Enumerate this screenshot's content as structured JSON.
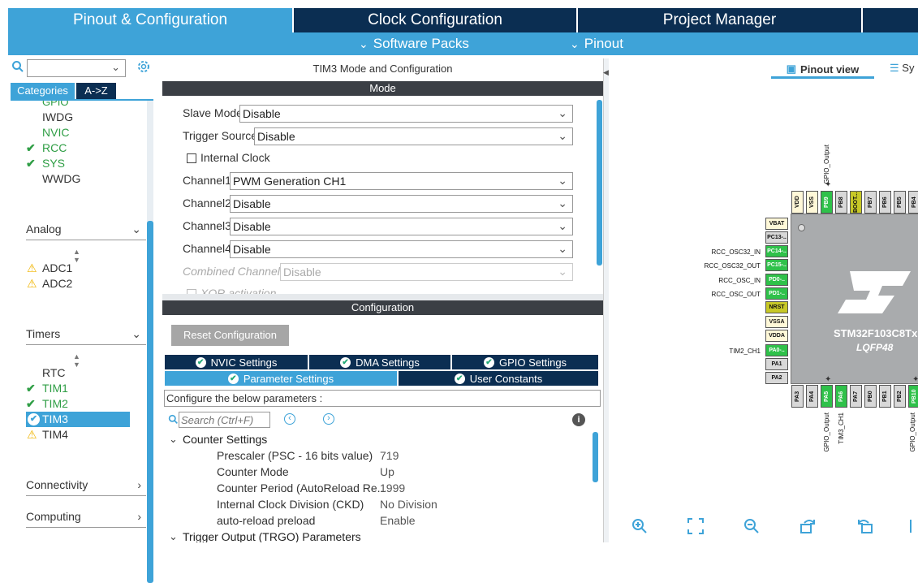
{
  "top_tabs": [
    "Pinout & Configuration",
    "Clock Configuration",
    "Project Manager"
  ],
  "sub_nav": [
    "Software Packs",
    "Pinout"
  ],
  "left": {
    "search_value": "",
    "tabs": [
      "Categories",
      "A->Z"
    ],
    "partial_item": "GPIO",
    "system_items": [
      {
        "label": "IWDG",
        "status": "none"
      },
      {
        "label": "NVIC",
        "status": "none-green"
      },
      {
        "label": "RCC",
        "status": "check"
      },
      {
        "label": "SYS",
        "status": "check"
      },
      {
        "label": "WWDG",
        "status": "none"
      }
    ],
    "analog_label": "Analog",
    "analog_items": [
      "ADC1",
      "ADC2"
    ],
    "timers_label": "Timers",
    "timer_items": [
      {
        "label": "RTC",
        "status": "none"
      },
      {
        "label": "TIM1",
        "status": "check"
      },
      {
        "label": "TIM2",
        "status": "check"
      },
      {
        "label": "TIM3",
        "status": "selected"
      },
      {
        "label": "TIM4",
        "status": "warn"
      }
    ],
    "connectivity_label": "Connectivity",
    "computing_label": "Computing"
  },
  "mode": {
    "title": "TIM3 Mode and Configuration",
    "header": "Mode",
    "slave_mode_label": "Slave Mode",
    "slave_mode_value": "Disable",
    "trigger_source_label": "Trigger Source",
    "trigger_source_value": "Disable",
    "internal_clock_label": "Internal Clock",
    "channel1_label": "Channel1",
    "channel1_value": "PWM Generation CH1",
    "channel2_label": "Channel2",
    "channel2_value": "Disable",
    "channel3_label": "Channel3",
    "channel3_value": "Disable",
    "channel4_label": "Channel4",
    "channel4_value": "Disable",
    "combined_label": "Combined Channels",
    "combined_value": "Disable",
    "xor_label": "XOR activation"
  },
  "config": {
    "header": "Configuration",
    "reset_button": "Reset Configuration",
    "tabs_row1": [
      "NVIC Settings",
      "DMA Settings",
      "GPIO Settings"
    ],
    "tabs_row2": [
      "Parameter Settings",
      "User Constants"
    ],
    "configure_text": "Configure the below parameters :",
    "search_placeholder": "Search (Ctrl+F)",
    "counter_settings": "Counter Settings",
    "params": [
      {
        "label": "Prescaler (PSC - 16 bits value)",
        "value": "719"
      },
      {
        "label": "Counter Mode",
        "value": "Up"
      },
      {
        "label": "Counter Period (AutoReload Re...",
        "value": "1999"
      },
      {
        "label": "Internal Clock Division (CKD)",
        "value": "No Division"
      },
      {
        "label": "auto-reload preload",
        "value": "Enable"
      }
    ],
    "trigger_output": "Trigger Output (TRGO) Parameters"
  },
  "pinout": {
    "view_tab": "Pinout view",
    "system_tab": "Sy",
    "chip_name": "STM32F103C8Tx",
    "package": "LQFP48",
    "top_pins": [
      "VDD",
      "VSS",
      "PB9",
      "PB8",
      "BOOT...",
      "PB7",
      "PB6",
      "PB5",
      "PB4"
    ],
    "top_signal": "GPIO_Output",
    "left_pins": [
      "VBAT",
      "PC13-..",
      "PC14-..",
      "PC15-..",
      "PD0-..",
      "PD1-..",
      "NRST",
      "VSSA",
      "VDDA",
      "PA0-..",
      "PA1",
      "PA2"
    ],
    "left_signals": [
      "RCC_OSC32_IN",
      "RCC_OSC32_OUT",
      "RCC_OSC_IN",
      "RCC_OSC_OUT",
      "TIM2_CH1"
    ],
    "bottom_pins": [
      "PA3",
      "PA4",
      "PA5",
      "PA6",
      "PA7",
      "PB0",
      "PB1",
      "PB2",
      "PB10"
    ],
    "bottom_signals": [
      "GPIO_Output",
      "TIM3_CH1",
      "GPIO_Output"
    ]
  }
}
